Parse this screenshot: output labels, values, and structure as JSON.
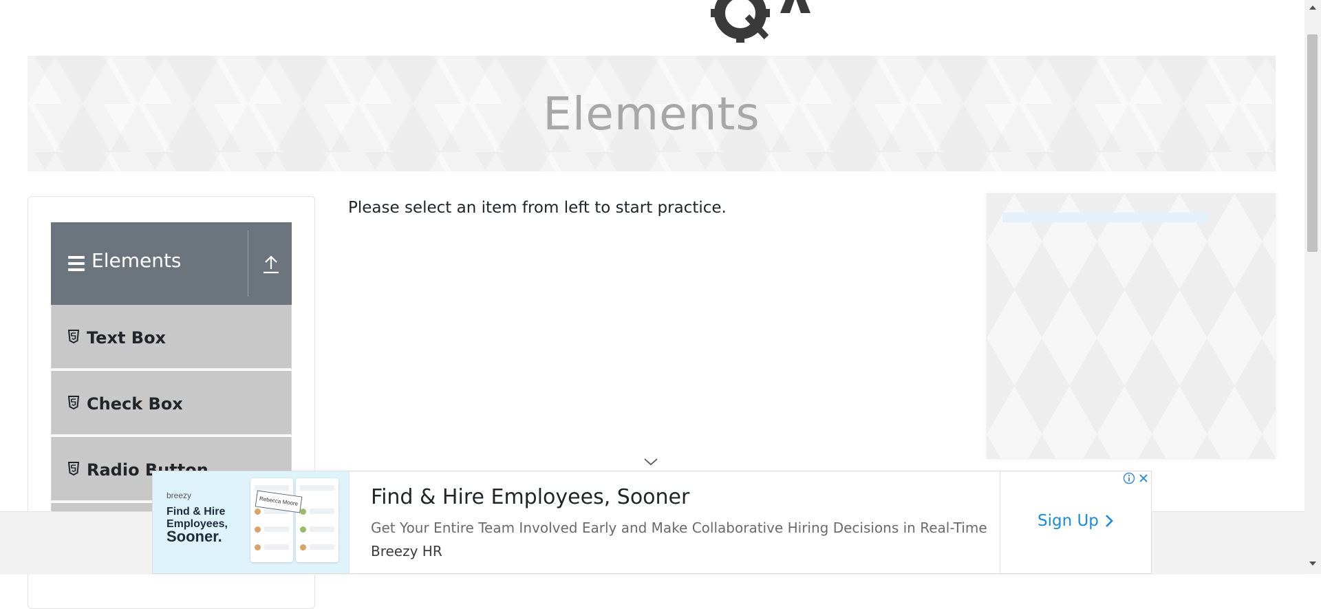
{
  "logo": {
    "text": "TOOLSQA"
  },
  "banner": {
    "title": "Elements"
  },
  "sidebar": {
    "group_title": "Elements",
    "items": [
      {
        "label": "Text Box"
      },
      {
        "label": "Check Box"
      },
      {
        "label": "Radio Button"
      },
      {
        "label": ""
      }
    ]
  },
  "main": {
    "instruction": "Please select an item from left to start practice."
  },
  "ad": {
    "brand": "breezy",
    "image_title_line1": "Find & Hire",
    "image_title_line2": "Employees,",
    "image_title_line3": "Sooner.",
    "card_name": "Rebecca Moore",
    "headline": "Find & Hire Employees, Sooner",
    "description": "Get Your Entire Team Involved Early and Make Collaborative Hiring Decisions in Real-Time",
    "advertiser": "Breezy HR",
    "cta_label": "Sign Up"
  },
  "colors": {
    "logo_blue": "#17a2e6",
    "sidebar_header": "#6c757d",
    "menu_item": "#c8c8c8",
    "cta_blue": "#1a8cd8"
  },
  "icons": {
    "menu": "hamburger-icon",
    "collapse": "upload-arrow-icon",
    "item": "html5-shield-icon",
    "chevron": "chevron-down-icon",
    "ad_info": "info-icon",
    "ad_close": "close-icon"
  }
}
